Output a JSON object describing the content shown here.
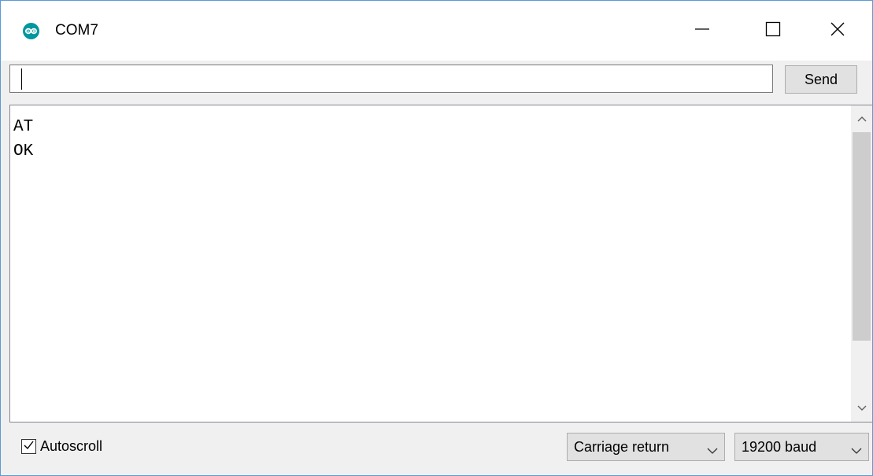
{
  "window": {
    "title": "COM7",
    "icon": "arduino-infinity-icon",
    "controls": {
      "minimize": "minimize-icon",
      "maximize": "maximize-icon",
      "close": "close-icon"
    }
  },
  "input": {
    "value": "",
    "send_label": "Send"
  },
  "output": {
    "lines": [
      "AT",
      "OK"
    ]
  },
  "footer": {
    "autoscroll_label": "Autoscroll",
    "autoscroll_checked": true,
    "line_ending": "Carriage return",
    "baud": "19200 baud"
  },
  "colors": {
    "accent": "#00979d",
    "window_border": "#5b9bd5"
  }
}
